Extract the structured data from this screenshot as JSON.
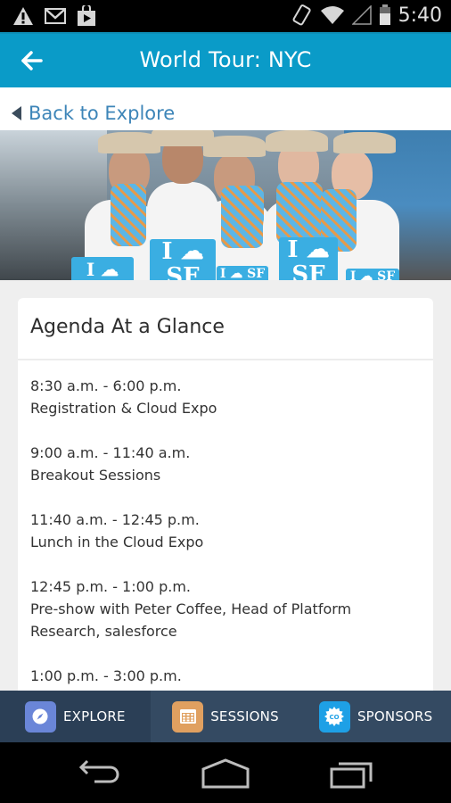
{
  "status_bar": {
    "time": "5:40",
    "icons_left": [
      "warning-icon",
      "gmail-icon",
      "play-store-icon"
    ],
    "icons_right": [
      "rotate-icon",
      "wifi-icon",
      "signal-icon",
      "battery-icon"
    ]
  },
  "header": {
    "title": "World Tour: NYC",
    "back_icon": "arrow-left-icon",
    "color": "#0a9bc8"
  },
  "back_link": {
    "label": "Back to Explore"
  },
  "hero": {
    "sign_text": "I ☁ SF"
  },
  "card": {
    "title": "Agenda At a Glance",
    "items": [
      {
        "time": "8:30 a.m. - 6:00 p.m.",
        "desc": "Registration & Cloud Expo"
      },
      {
        "time": "9:00 a.m. - 11:40 a.m.",
        "desc": "Breakout Sessions"
      },
      {
        "time": "11:40 a.m. - 12:45 p.m.",
        "desc": "Lunch in the Cloud Expo"
      },
      {
        "time": "12:45 p.m. - 1:00 p.m.",
        "desc": "Pre-show with Peter Coffee, Head of Platform Research, salesforce"
      },
      {
        "time": "1:00 p.m. - 3:00 p.m.",
        "desc": ""
      }
    ]
  },
  "tabs": [
    {
      "label": "EXPLORE",
      "icon": "compass-icon",
      "color": "#6a86d8",
      "active": true
    },
    {
      "label": "SESSIONS",
      "icon": "calendar-icon",
      "color": "#e0a060",
      "active": false
    },
    {
      "label": "SPONSORS",
      "icon": "badge-icon",
      "color": "#1ea0e6",
      "active": false
    }
  ],
  "nav": {
    "buttons": [
      "back-icon",
      "home-icon",
      "recents-icon"
    ]
  }
}
